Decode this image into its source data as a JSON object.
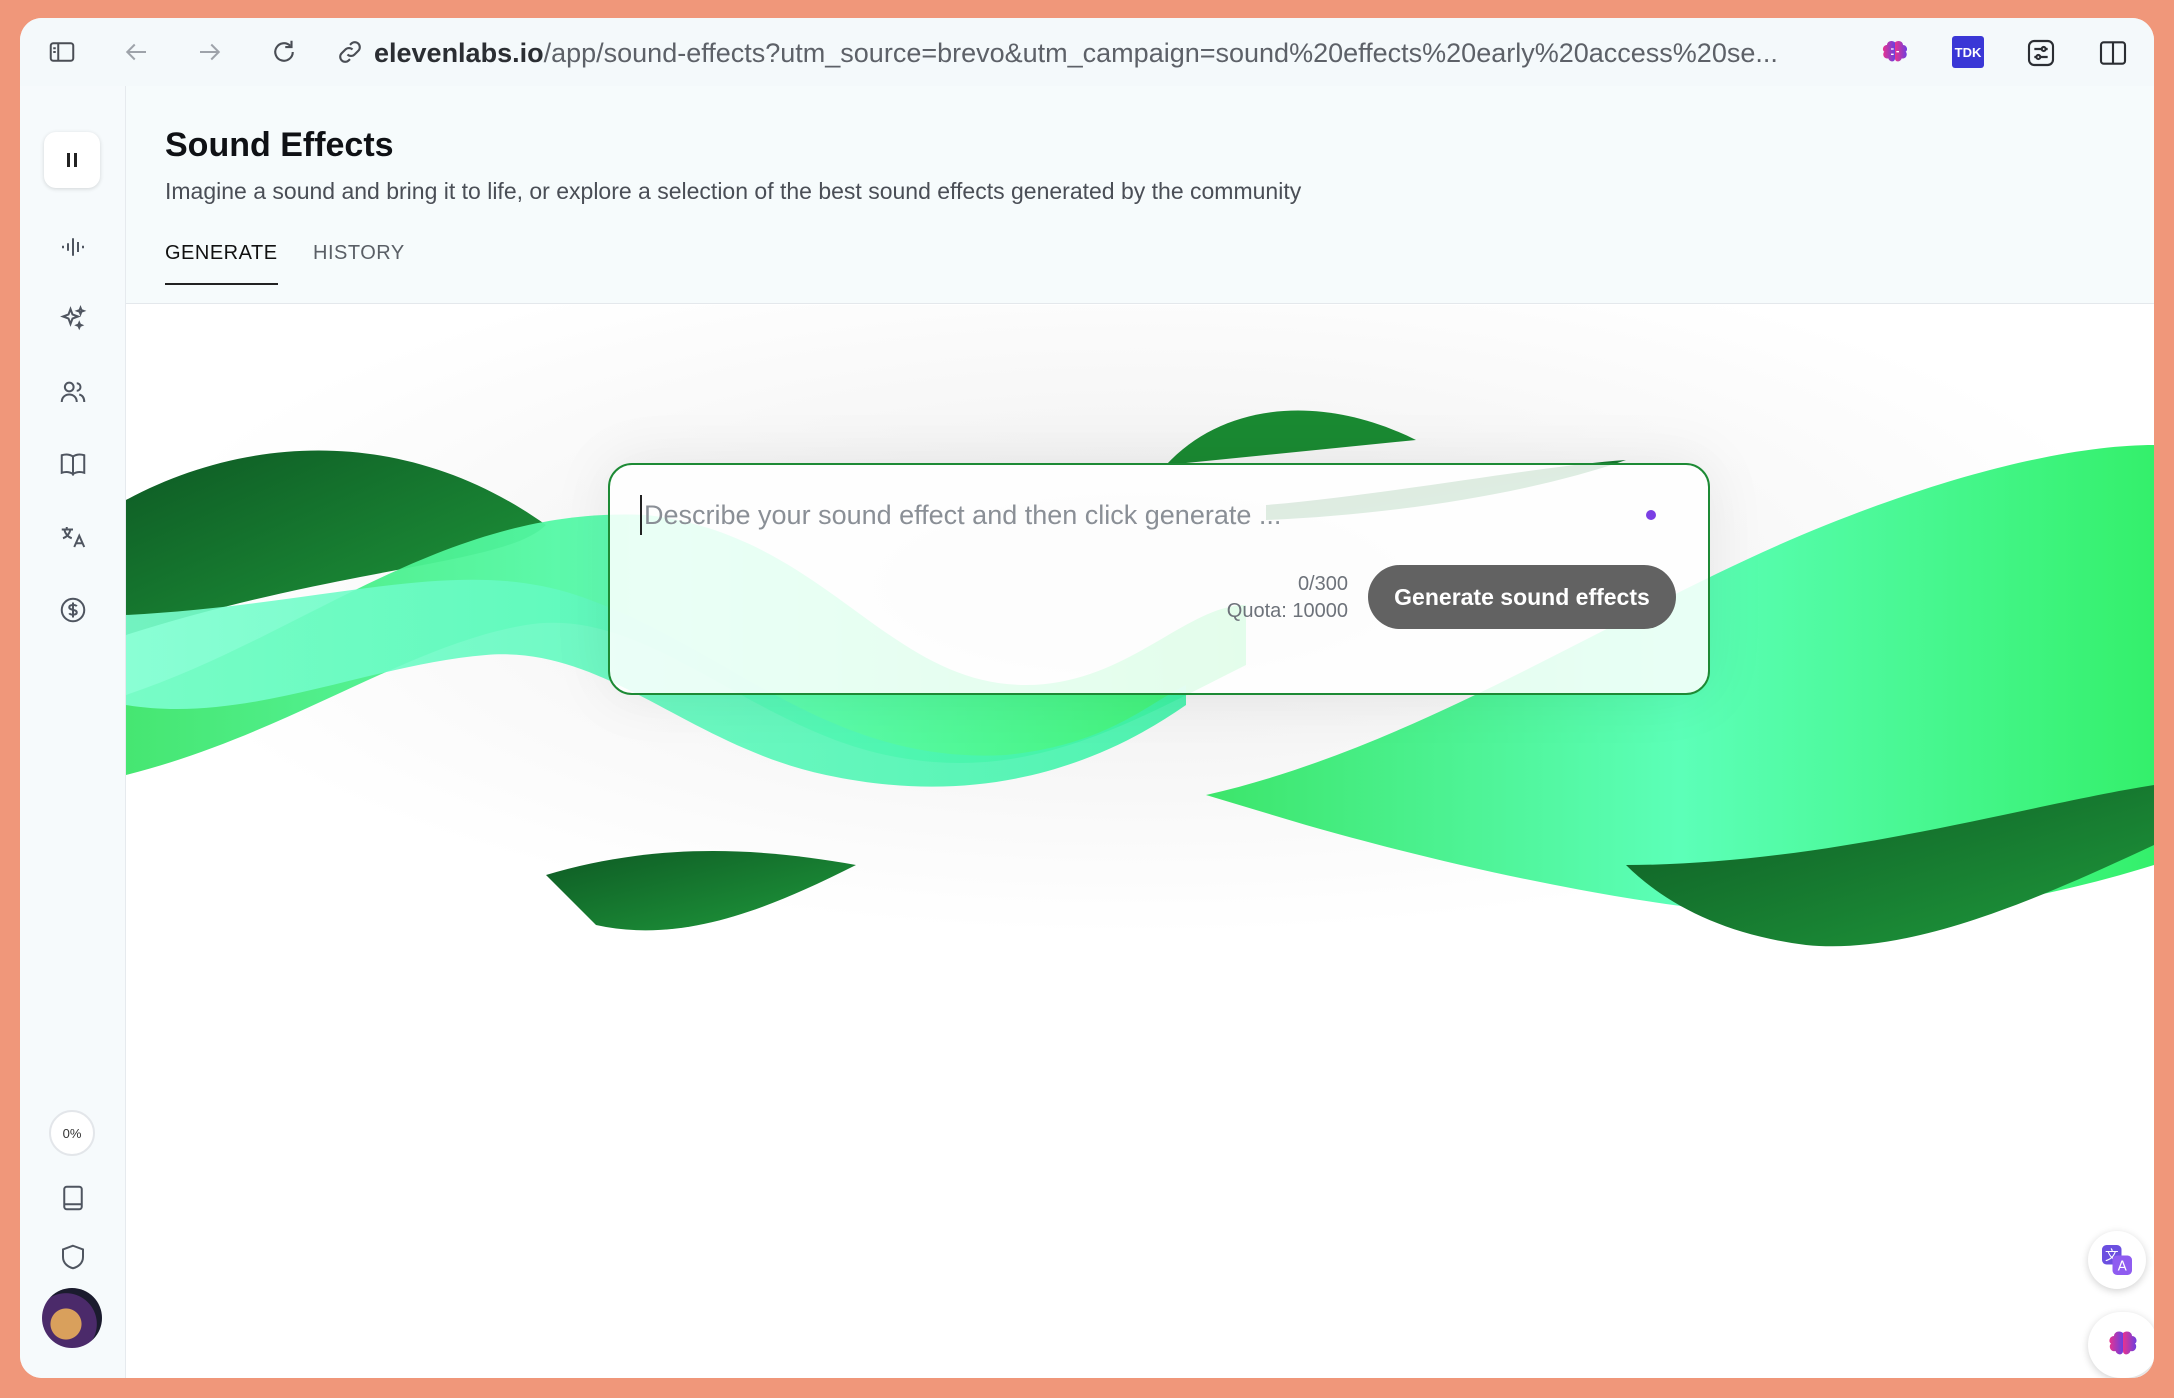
{
  "browser": {
    "url_host": "elevenlabs.io",
    "url_path": "/app/sound-effects?utm_source=brevo&utm_campaign=sound%20effects%20early%20access%20se...",
    "extension_tdk_label": "TDK"
  },
  "sidebar": {
    "progress_label": "0%"
  },
  "header": {
    "title": "Sound Effects",
    "subtitle": "Imagine a sound and bring it to life, or explore a selection of the best sound effects generated by the community",
    "tabs": [
      {
        "label": "GENERATE",
        "active": true
      },
      {
        "label": "HISTORY",
        "active": false
      }
    ]
  },
  "generator": {
    "placeholder": "Describe your sound effect and then click generate ...",
    "value": "",
    "char_count": "0/300",
    "quota": "Quota: 10000",
    "button_label": "Generate sound effects"
  },
  "colors": {
    "accent_green": "#1d8a35",
    "button_gray": "#626262",
    "frame": "#f0977a"
  }
}
